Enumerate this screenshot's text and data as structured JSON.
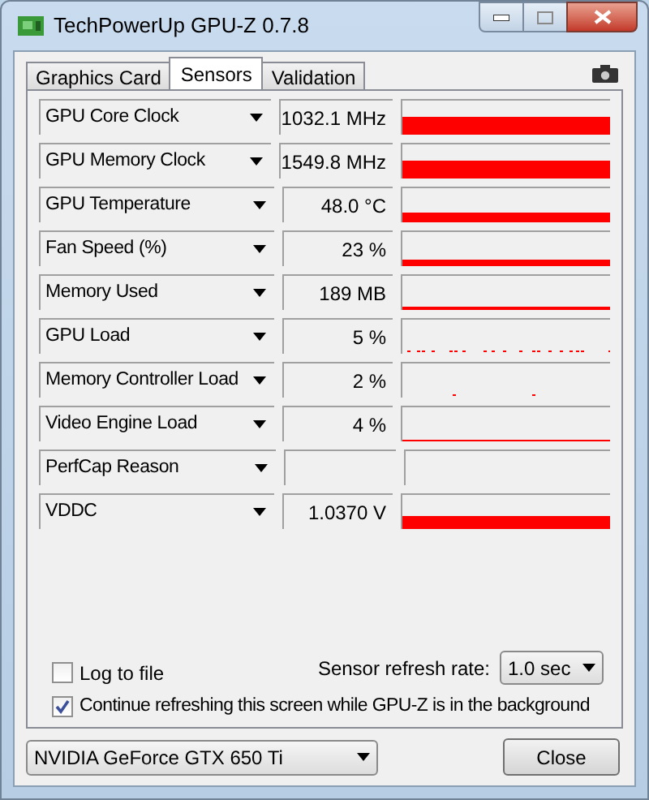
{
  "window": {
    "title": "TechPowerUp GPU-Z 0.7.8"
  },
  "tabs": [
    {
      "label": "Graphics Card",
      "selected": false
    },
    {
      "label": "Sensors",
      "selected": true
    },
    {
      "label": "Validation",
      "selected": false
    }
  ],
  "sensors": [
    {
      "name": "GPU Core Clock",
      "value": "1032.1 MHz",
      "kind": "high"
    },
    {
      "name": "GPU Memory Clock",
      "value": "1549.8 MHz",
      "kind": "high"
    },
    {
      "name": "GPU Temperature",
      "value": "48.0 °C",
      "kind": "medium"
    },
    {
      "name": "Fan Speed (%)",
      "value": "23 %",
      "kind": "low"
    },
    {
      "name": "Memory Used",
      "value": "189 MB",
      "kind": "line"
    },
    {
      "name": "GPU Load",
      "value": "5 %",
      "kind": "dots"
    },
    {
      "name": "Memory Controller Load",
      "value": "2 %",
      "kind": "sparse"
    },
    {
      "name": "Video Engine Load",
      "value": "4 %",
      "kind": "thin"
    },
    {
      "name": "PerfCap Reason",
      "kind": "empty"
    },
    {
      "name": "VDDC",
      "value": "1.0370 V",
      "kind": "mid"
    }
  ],
  "log_to_file": {
    "label": "Log to file",
    "checked": false
  },
  "refresh_rate": {
    "label": "Sensor refresh rate:",
    "value": "1.0 sec"
  },
  "continue_refreshing": {
    "label": "Continue refreshing this screen while GPU-Z is in the background",
    "checked": true
  },
  "gpu_select": {
    "value": "NVIDIA GeForce GTX 650 Ti"
  },
  "close_button": "Close"
}
